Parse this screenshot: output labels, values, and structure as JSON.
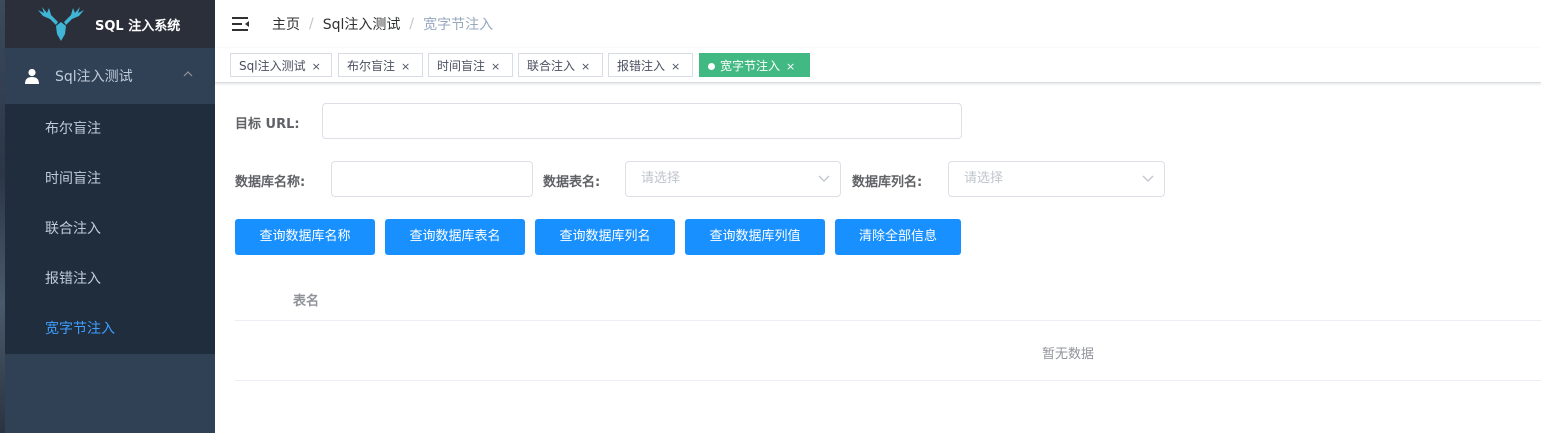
{
  "sidebar": {
    "app_title": "SQL 注入系统",
    "group_label": "Sql注入测试",
    "items": [
      {
        "label": "布尔盲注"
      },
      {
        "label": "时间盲注"
      },
      {
        "label": "联合注入"
      },
      {
        "label": "报错注入"
      },
      {
        "label": "宽字节注入"
      }
    ],
    "active_color": "#409eff"
  },
  "breadcrumb": [
    "主页",
    "Sql注入测试",
    "宽字节注入"
  ],
  "breadcrumb_separator": "/",
  "tags": [
    {
      "label": "Sql注入测试"
    },
    {
      "label": "布尔盲注"
    },
    {
      "label": "时间盲注"
    },
    {
      "label": "联合注入"
    },
    {
      "label": "报错注入"
    },
    {
      "label": "宽字节注入"
    }
  ],
  "tag_close": "×",
  "form": {
    "url_label": "目标 URL:",
    "url_value": "",
    "db_label": "数据库名称:",
    "db_value": "",
    "table_label": "数据表名:",
    "table_placeholder": "请选择",
    "column_label": "数据库列名:",
    "column_placeholder": "请选择"
  },
  "buttons": {
    "query_db": "查询数据库名称",
    "query_tables": "查询数据库表名",
    "query_columns": "查询数据库列名",
    "query_values": "查询数据库列值",
    "clear_all": "清除全部信息"
  },
  "table": {
    "column_header": "表名",
    "empty_text": "暂无数据"
  },
  "colors": {
    "sidebar_bg": "#304156",
    "active_tag": "#42b983",
    "primary_button": "#1890ff"
  }
}
